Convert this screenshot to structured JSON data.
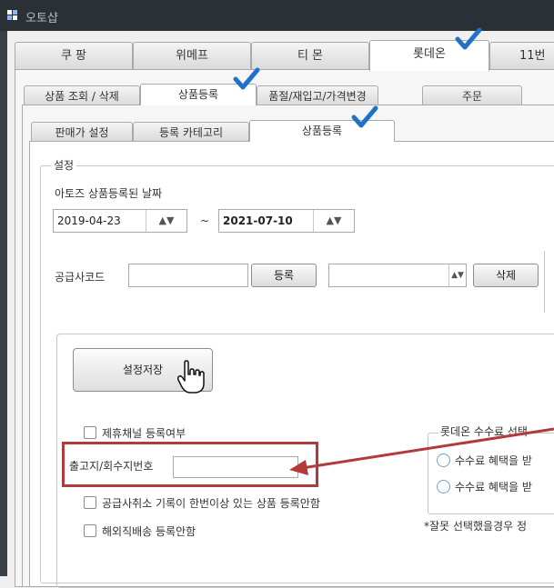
{
  "window": {
    "title": "오토샵"
  },
  "tabs": {
    "marketplaces": [
      "쿠 팡",
      "위메프",
      "티 몬",
      "롯데온",
      "11번"
    ],
    "sections": [
      "상품 조회 / 삭제",
      "상품등록",
      "품절/재입고/가격변경",
      "주문"
    ],
    "subsections": [
      "판매가 설정",
      "등록 카테고리",
      "상품등록"
    ]
  },
  "settings": {
    "group_label": "설정",
    "date_label": "아토즈 상품등록된 날짜",
    "date_from": "2019-04-23",
    "date_to": "2021-07-10",
    "date_sep": "~",
    "supplier_label": "공급사코드",
    "supplier_value": "",
    "register_button": "등록",
    "supplier_select_value": "",
    "delete_button": "삭제",
    "save_button": "설정저장",
    "checkbox_affiliate": "제휴채널 등록여부",
    "shipping_label": "출고지/회수지번호",
    "shipping_value": "",
    "checkbox_supplier_cancel": "공급사취소 기록이 한번이상 있는 상품 등록안함",
    "checkbox_overseas": "해외직배송 등록안함",
    "fee_group_label": "롯데온 수수료 선택",
    "fee_option1": "수수료 혜택을 받",
    "fee_option2": "수수료 혜택을 받",
    "fee_note": "*잘못 선택했을경우 정"
  },
  "colors": {
    "accent_check": "#1e73c8",
    "highlight_box": "#b23a3a",
    "titlebar": "#2b2f36"
  }
}
